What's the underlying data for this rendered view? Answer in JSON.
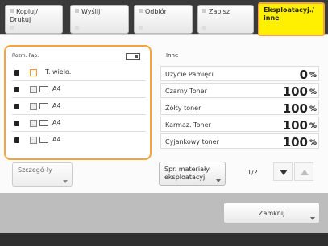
{
  "tabs": [
    {
      "label": "Kopiuj/ Drukuj"
    },
    {
      "label": "Wyślij"
    },
    {
      "label": "Odbiór"
    },
    {
      "label": "Zapisz"
    },
    {
      "label": "Eksploatacyj./ inne"
    }
  ],
  "left_panel": {
    "header": "Rozm. Pap.",
    "rows": [
      {
        "text": "T. wielo."
      },
      {
        "text": "A4"
      },
      {
        "text": "A4"
      },
      {
        "text": "A4"
      },
      {
        "text": "A4"
      }
    ],
    "button": "Szczegó-ły"
  },
  "right_panel": {
    "title": "Inne",
    "items": [
      {
        "label": "Użycie Pamięci",
        "value": "0",
        "unit": "%"
      },
      {
        "label": "Czarny Toner",
        "value": "100",
        "unit": "%"
      },
      {
        "label": "Żółty toner",
        "value": "100",
        "unit": "%"
      },
      {
        "label": "Karmaz. Toner",
        "value": "100",
        "unit": "%"
      },
      {
        "label": "Cyjankowy toner",
        "value": "100",
        "unit": "%"
      }
    ],
    "consumables_button": "Spr. materiały eksploatacyj.",
    "page_indicator": "1/2"
  },
  "close_button": "Zamknij",
  "colors": {
    "active_tab": "#ffef00",
    "accent": "#f3a43a"
  }
}
